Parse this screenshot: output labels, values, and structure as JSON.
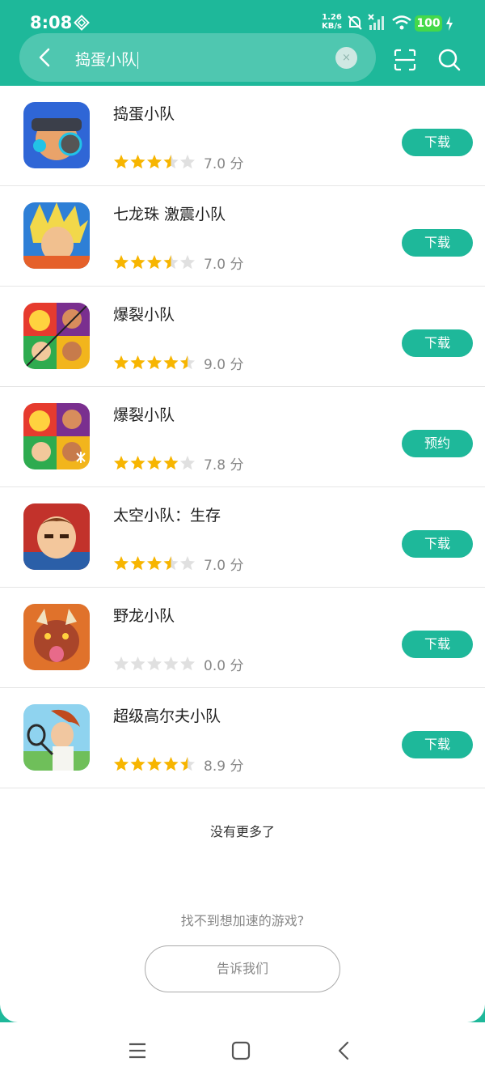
{
  "status_bar": {
    "time": "8:08",
    "net_speed_value": "1.26",
    "net_speed_unit": "KB/s",
    "battery": "100"
  },
  "search": {
    "query": "捣蛋小队",
    "clear_glyph": "×"
  },
  "results": [
    {
      "name": "捣蛋小队",
      "rating": 3.5,
      "score": "7.0 分",
      "action": "下载"
    },
    {
      "name": "七龙珠 激震小队",
      "rating": 3.5,
      "score": "7.0 分",
      "action": "下载"
    },
    {
      "name": "爆裂小队",
      "rating": 4.5,
      "score": "9.0 分",
      "action": "下载"
    },
    {
      "name": "爆裂小队",
      "rating": 4.0,
      "score": "7.8 分",
      "action": "预约"
    },
    {
      "name": "太空小队：生存",
      "rating": 3.5,
      "score": "7.0 分",
      "action": "下载"
    },
    {
      "name": "野龙小队",
      "rating": 0,
      "score": "0.0 分",
      "action": "下载"
    },
    {
      "name": "超级高尔夫小队",
      "rating": 4.5,
      "score": "8.9 分",
      "action": "下载"
    }
  ],
  "footer": {
    "no_more": "没有更多了",
    "hint": "找不到想加速的游戏?",
    "tell_us": "告诉我们"
  },
  "colors": {
    "accent": "#1eb89a",
    "star_on": "#f7b500",
    "star_off": "#e0e0e0"
  },
  "icons": [
    "back-icon",
    "clear-icon",
    "scan-icon",
    "search-icon",
    "star-icon",
    "menu-icon",
    "home-icon",
    "nav-back-icon"
  ]
}
